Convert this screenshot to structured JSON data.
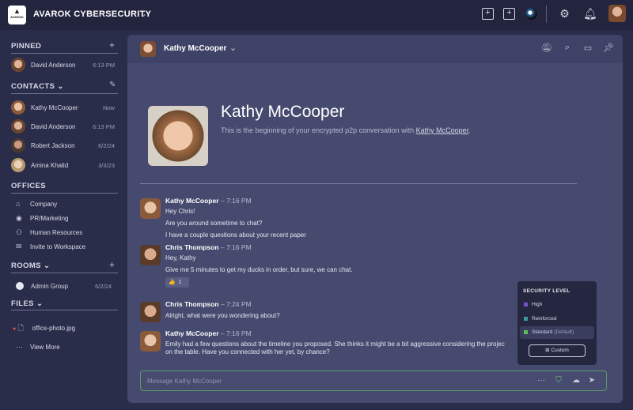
{
  "topbar": {
    "logo_text": "AVAROK",
    "org_name": "AVAROK CYBERSECURITY"
  },
  "sidebar": {
    "pinned_label": "PINNED",
    "pinned": [
      {
        "name": "David Anderson",
        "time": "6:13 PM"
      }
    ],
    "contacts_label": "CONTACTS",
    "contacts": [
      {
        "name": "Kathy McCooper",
        "time": "Now"
      },
      {
        "name": "David Anderson",
        "time": "6:13 PM"
      },
      {
        "name": "Robert Jackson",
        "time": "6/2/24"
      },
      {
        "name": "Amina Khalid",
        "time": "3/3/23"
      }
    ],
    "offices_label": "OFFICES",
    "offices": [
      {
        "label": "Company",
        "icon": "home-icon"
      },
      {
        "label": "PR/Marketing",
        "icon": "eye-icon"
      },
      {
        "label": "Human Resources",
        "icon": "users-icon"
      },
      {
        "label": "Invite to Workspace",
        "icon": "mail-icon"
      }
    ],
    "rooms_label": "ROOMS",
    "rooms": [
      {
        "name": "Admin Group",
        "time": "6/2/24"
      }
    ],
    "files_label": "FILES",
    "files": [
      {
        "name": "office-photo.jpg"
      }
    ],
    "view_more": "View More"
  },
  "chat": {
    "header_name": "Kathy McCooper",
    "hero_name": "Kathy McCooper",
    "hero_sub_prefix": "This is the beginning of your encrypted p2p conversation with ",
    "hero_sub_link": "Kathy McCooper",
    "hero_sub_suffix": ".",
    "messages": [
      {
        "author": "Kathy McCooper",
        "time": "– 7:16 PM",
        "lines": [
          "Hey Chris!",
          "Are you around sometime to chat?",
          "I have a couple questions about your recent paper"
        ]
      },
      {
        "author": "Chris Thompson",
        "time": "– 7:16 PM",
        "lines": [
          "Hey, Kathy",
          "Give me 5 minutes to get my ducks in order, but sure, we can chat."
        ],
        "reaction": {
          "emoji": "👍",
          "count": "1"
        }
      },
      {
        "author": "Chris Thompson",
        "time": "– 7:24 PM",
        "lines": [
          "Alright, what were you wondering about?"
        ]
      },
      {
        "author": "Kathy McCooper",
        "time": "– 7:16 PM",
        "lines": [
          "Emily had a few questions about the timeline you proposed. She thinks it might be a bit aggressive considering the projec",
          "on the table. Have you connected with her yet, by chance?"
        ]
      }
    ],
    "composer_placeholder": "Message Kathy McCooper"
  },
  "security_popup": {
    "title": "SECURITY LEVEL",
    "levels": [
      {
        "label": "High",
        "color": "#7a4fd0"
      },
      {
        "label": "Reinforced",
        "color": "#3a9aa0"
      },
      {
        "label": "Standard",
        "suffix": "(Default)",
        "color": "#5bbf5a"
      }
    ],
    "custom_label": "Custom"
  }
}
